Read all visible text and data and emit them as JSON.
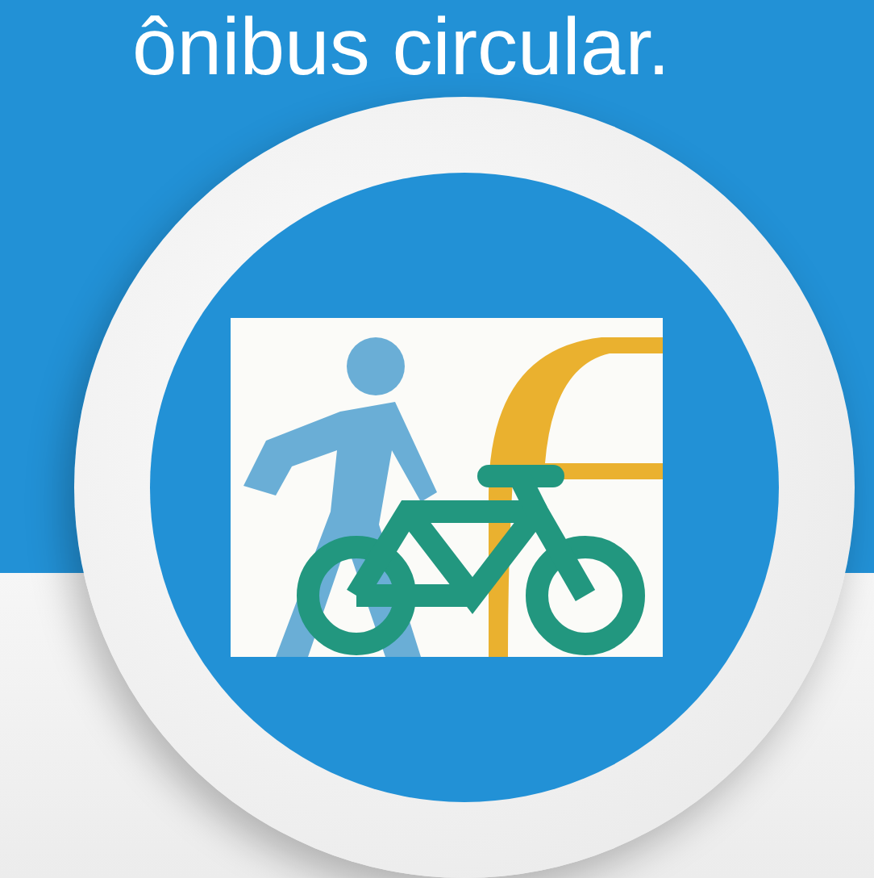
{
  "heading": {
    "text": "ônibus circular."
  }
}
